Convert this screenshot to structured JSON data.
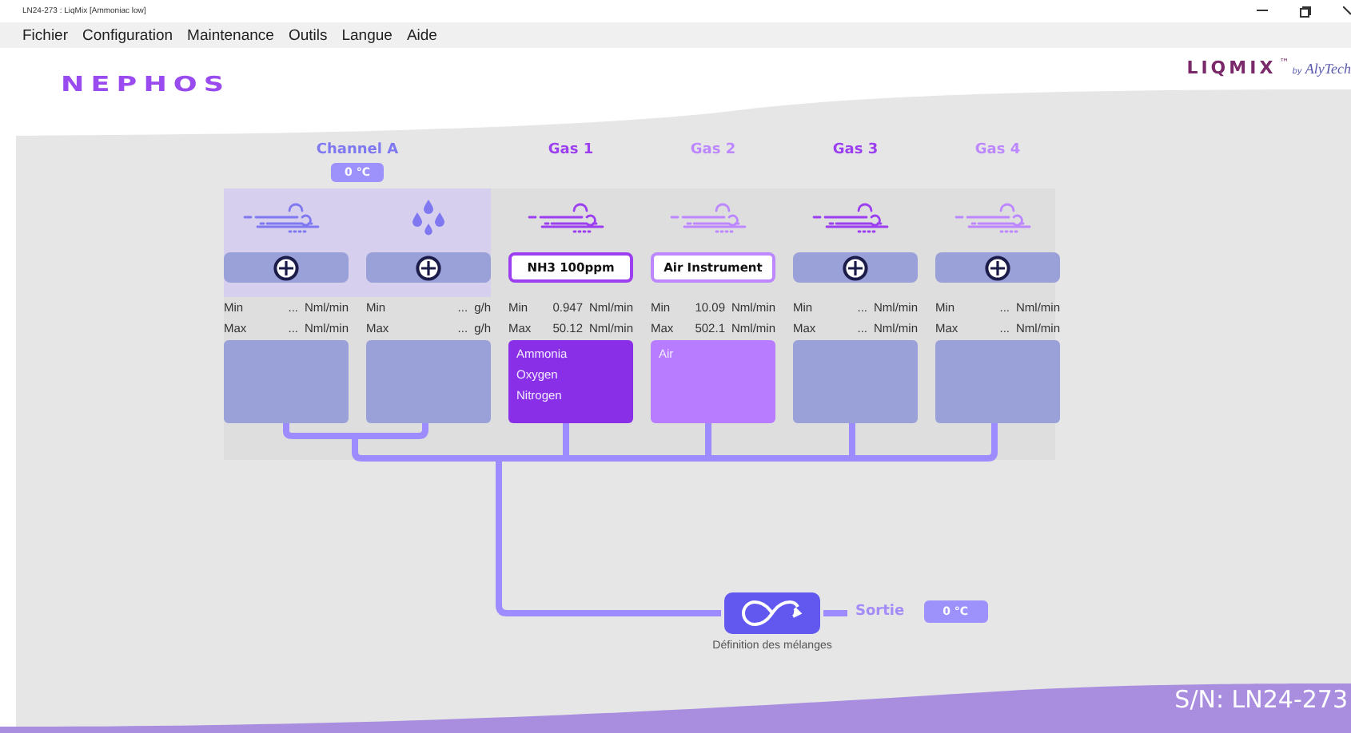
{
  "window": {
    "title": "LN24-273 : LiqMix [Ammoniac low]"
  },
  "menu": [
    "Fichier",
    "Configuration",
    "Maintenance",
    "Outils",
    "Langue",
    "Aide"
  ],
  "header": {
    "logo": "NEPHOS",
    "brand": "LIQMIX",
    "trademark": "™",
    "by": "by",
    "maker": "AlyTech"
  },
  "groups": [
    {
      "title": "Channel A",
      "color": "#7f78f0",
      "temperature": "0 °C",
      "columns": [
        {
          "kind": "gas",
          "min_label": "Min",
          "min": "...",
          "min_unit": "Nml/min",
          "max_label": "Max",
          "max": "...",
          "max_unit": "Nml/min"
        },
        {
          "kind": "liquid",
          "min_label": "Min",
          "min": "...",
          "min_unit": "g/h",
          "max_label": "Max",
          "max": "...",
          "max_unit": "g/h"
        }
      ]
    },
    {
      "title": "Gas 1",
      "color": "#9b3ff0",
      "columns": [
        {
          "kind": "gas",
          "product": "NH3 100ppm",
          "min_label": "Min",
          "min": "0.947",
          "min_unit": "Nml/min",
          "max_label": "Max",
          "max": "50.12",
          "max_unit": "Nml/min",
          "color": "#8a2fe8",
          "components": [
            "Ammonia",
            "Oxygen",
            "Nitrogen"
          ]
        }
      ]
    },
    {
      "title": "Gas 2",
      "color": "#bd88ff",
      "columns": [
        {
          "kind": "gas",
          "product": "Air Instrument",
          "min_label": "Min",
          "min": "10.09",
          "min_unit": "Nml/min",
          "max_label": "Max",
          "max": "502.1",
          "max_unit": "Nml/min",
          "color": "#b77cff",
          "components": [
            "Air"
          ]
        }
      ]
    },
    {
      "title": "Gas 3",
      "color": "#9b3ff0",
      "columns": [
        {
          "kind": "gas",
          "min_label": "Min",
          "min": "...",
          "min_unit": "Nml/min",
          "max_label": "Max",
          "max": "...",
          "max_unit": "Nml/min"
        }
      ]
    },
    {
      "title": "Gas 4",
      "color": "#bd88ff",
      "columns": [
        {
          "kind": "gas",
          "min_label": "Min",
          "min": "...",
          "min_unit": "Nml/min",
          "max_label": "Max",
          "max": "...",
          "max_unit": "Nml/min"
        }
      ]
    }
  ],
  "mixer": {
    "label": "Définition des mélanges",
    "output_label": "Sortie",
    "output_temperature": "0 °C"
  },
  "footer": {
    "serial": "S/N: LN24-273"
  }
}
